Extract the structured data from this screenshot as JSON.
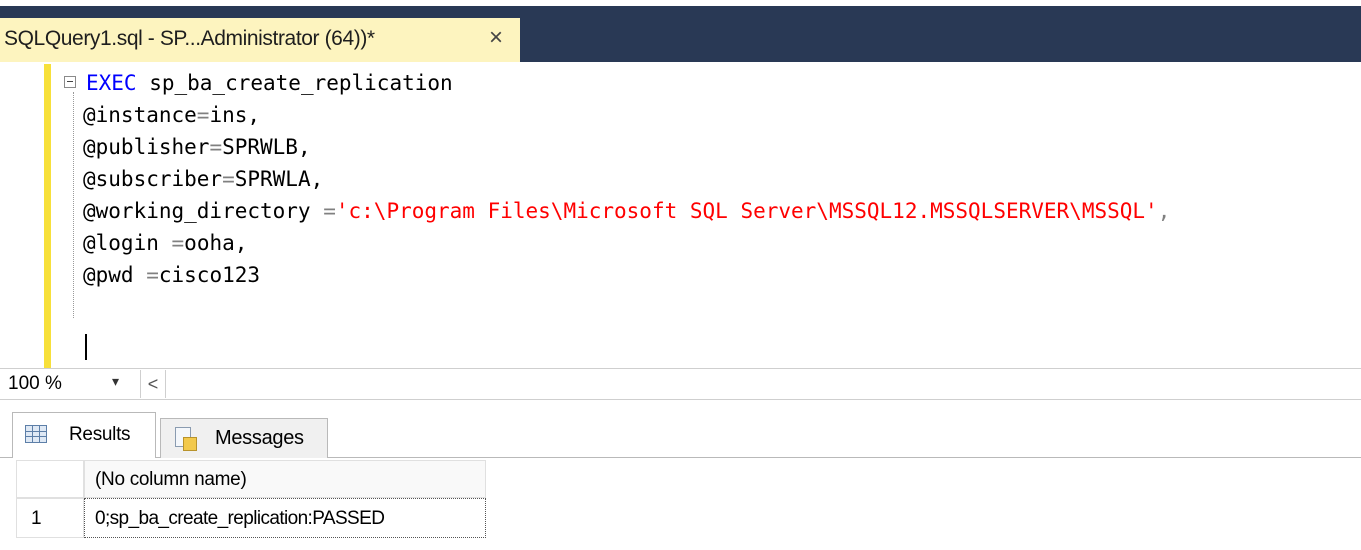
{
  "document_tab": {
    "title": "SQLQuery1.sql - SP...Administrator (64))*",
    "close_glyph": "×"
  },
  "editor": {
    "lines": [
      {
        "kw": "EXEC",
        "rest": " sp_ba_create_replication"
      },
      {
        "name": "@instance",
        "op": "=",
        "val": "ins,"
      },
      {
        "name": "@publisher",
        "op": "=",
        "val": "SPRWLB,"
      },
      {
        "name": "@subscriber",
        "op": "=",
        "val": "SPRWLA,"
      },
      {
        "name": "@working_directory ",
        "op": "=",
        "str": "'c:\\Program Files\\Microsoft SQL Server\\MSSQL12.MSSQLSERVER\\MSSQL'",
        "tail": ","
      },
      {
        "name": "@login ",
        "op": "=",
        "val": "ooha,"
      },
      {
        "name": "@pwd ",
        "op": "=",
        "val": "cisco123"
      }
    ]
  },
  "status": {
    "zoom": "100 %",
    "zoom_dropdown_glyph": "▾",
    "scroll_left_glyph": "<"
  },
  "result_tabs": {
    "results": "Results",
    "messages": "Messages"
  },
  "grid": {
    "column_header": "(No column name)",
    "rows": [
      {
        "num": "1",
        "value": "0;sp_ba_create_replication:PASSED"
      }
    ]
  },
  "colors": {
    "tab_strip": "#293955",
    "active_tab": "#fdf4bf",
    "keyword": "#0000ff",
    "string": "#ff0000",
    "change_bar": "#f7e03a"
  }
}
